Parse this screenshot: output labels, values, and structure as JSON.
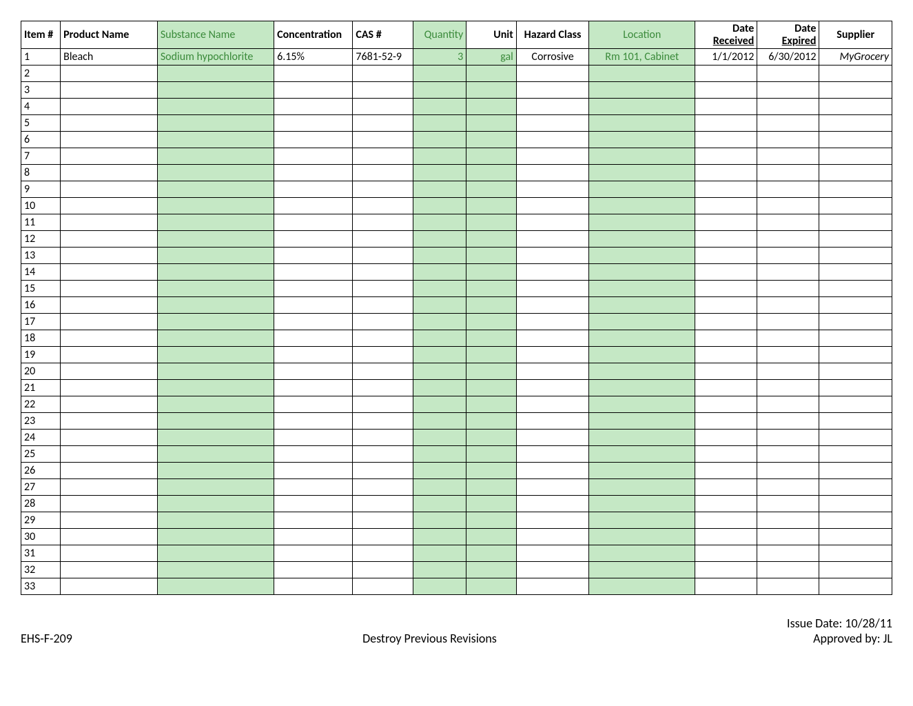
{
  "headers": {
    "item": "Item #",
    "product": "Product Name",
    "substance": "Substance Name",
    "concentration": "Concentration",
    "cas": "CAS #",
    "quantity": "Quantity",
    "unit": "Unit",
    "hazard": "Hazard Class",
    "location": "Location",
    "date_top": "Date",
    "date_received": "Received",
    "date_expired": "Expired",
    "supplier": "Supplier"
  },
  "row1": {
    "item": "1",
    "product": "Bleach",
    "substance": "Sodium hypochlorite",
    "concentration": "6.15%",
    "cas": "7681-52-9",
    "quantity": "3",
    "unit": "gal",
    "hazard": "Corrosive",
    "location": "Rm 101, Cabinet",
    "date_received": "1/1/2012",
    "date_expired": "6/30/2012",
    "supplier": "MyGrocery"
  },
  "row_count": 33,
  "footer": {
    "left": "EHS-F-209",
    "center": "Destroy Previous Revisions",
    "issue": "Issue Date: 10/28/11",
    "approved": "Approved by: JL"
  }
}
